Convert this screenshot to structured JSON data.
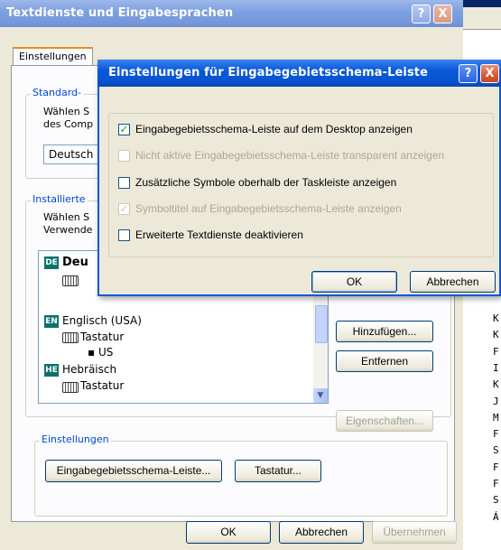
{
  "back_window": {
    "title": "Textdienste und Eingabesprachen",
    "help_label": "?",
    "close_label": "X",
    "tab_label": "Einstellungen",
    "default_group": {
      "label": "Standard-",
      "text_line1": "Wählen S",
      "text_line2": "des Comp",
      "dropdown_value": "Deutsch"
    },
    "installed_group": {
      "label": "Installierte",
      "text_line1": "Wählen S",
      "text_line2": "Verwende"
    },
    "languages": [
      {
        "badge": "DE",
        "name": "Deu"
      },
      {
        "badge": "EN",
        "name": "Englisch (USA)",
        "keyboard_label": "Tastatur",
        "layout": "US"
      },
      {
        "badge": "HE",
        "name": "Hebräisch",
        "keyboard_label": "Tastatur"
      }
    ],
    "buttons": {
      "add": "Hinzufügen...",
      "remove": "Entfernen",
      "properties": "Eigenschaften..."
    },
    "settings_group": {
      "label": "Einstellungen",
      "language_bar_button": "Eingabegebietsschema-Leiste...",
      "keyboard_button": "Tastatur..."
    },
    "footer": {
      "ok": "OK",
      "cancel": "Abbrechen",
      "apply": "Übernehmen"
    }
  },
  "right_column_chars": [
    "K",
    "K",
    "F",
    "I",
    "K",
    "J",
    "M",
    "F",
    "S",
    "F",
    "F",
    "S",
    "Á"
  ],
  "dialog": {
    "title": "Einstellungen für Eingabegebietsschema-Leiste",
    "help_label": "?",
    "close_label": "X",
    "options": [
      {
        "label": "Eingabegebietsschema-Leiste auf dem Desktop anzeigen",
        "checked": true,
        "enabled": true
      },
      {
        "label": "Nicht aktive Eingabegebietsschema-Leiste transparent anzeigen",
        "checked": false,
        "enabled": false
      },
      {
        "label": "Zusätzliche Symbole oberhalb der Taskleiste anzeigen",
        "checked": false,
        "enabled": true
      },
      {
        "label": "Symboltitel auf Eingabegebietsschema-Leiste anzeigen",
        "checked": true,
        "enabled": false
      },
      {
        "label": "Erweiterte Textdienste deaktivieren",
        "checked": false,
        "enabled": true
      }
    ],
    "ok": "OK",
    "cancel": "Abbrechen",
    "check_glyph": "✓"
  },
  "colors": {
    "active_title": "#0a58d8",
    "inactive_title": "#7b9fe0",
    "dialog_face": "#ece9d8",
    "group_label": "#0046d5",
    "badge_de": "#0d6f6e",
    "badge_en": "#0d6f6e",
    "badge_he": "#0d6f6e"
  }
}
